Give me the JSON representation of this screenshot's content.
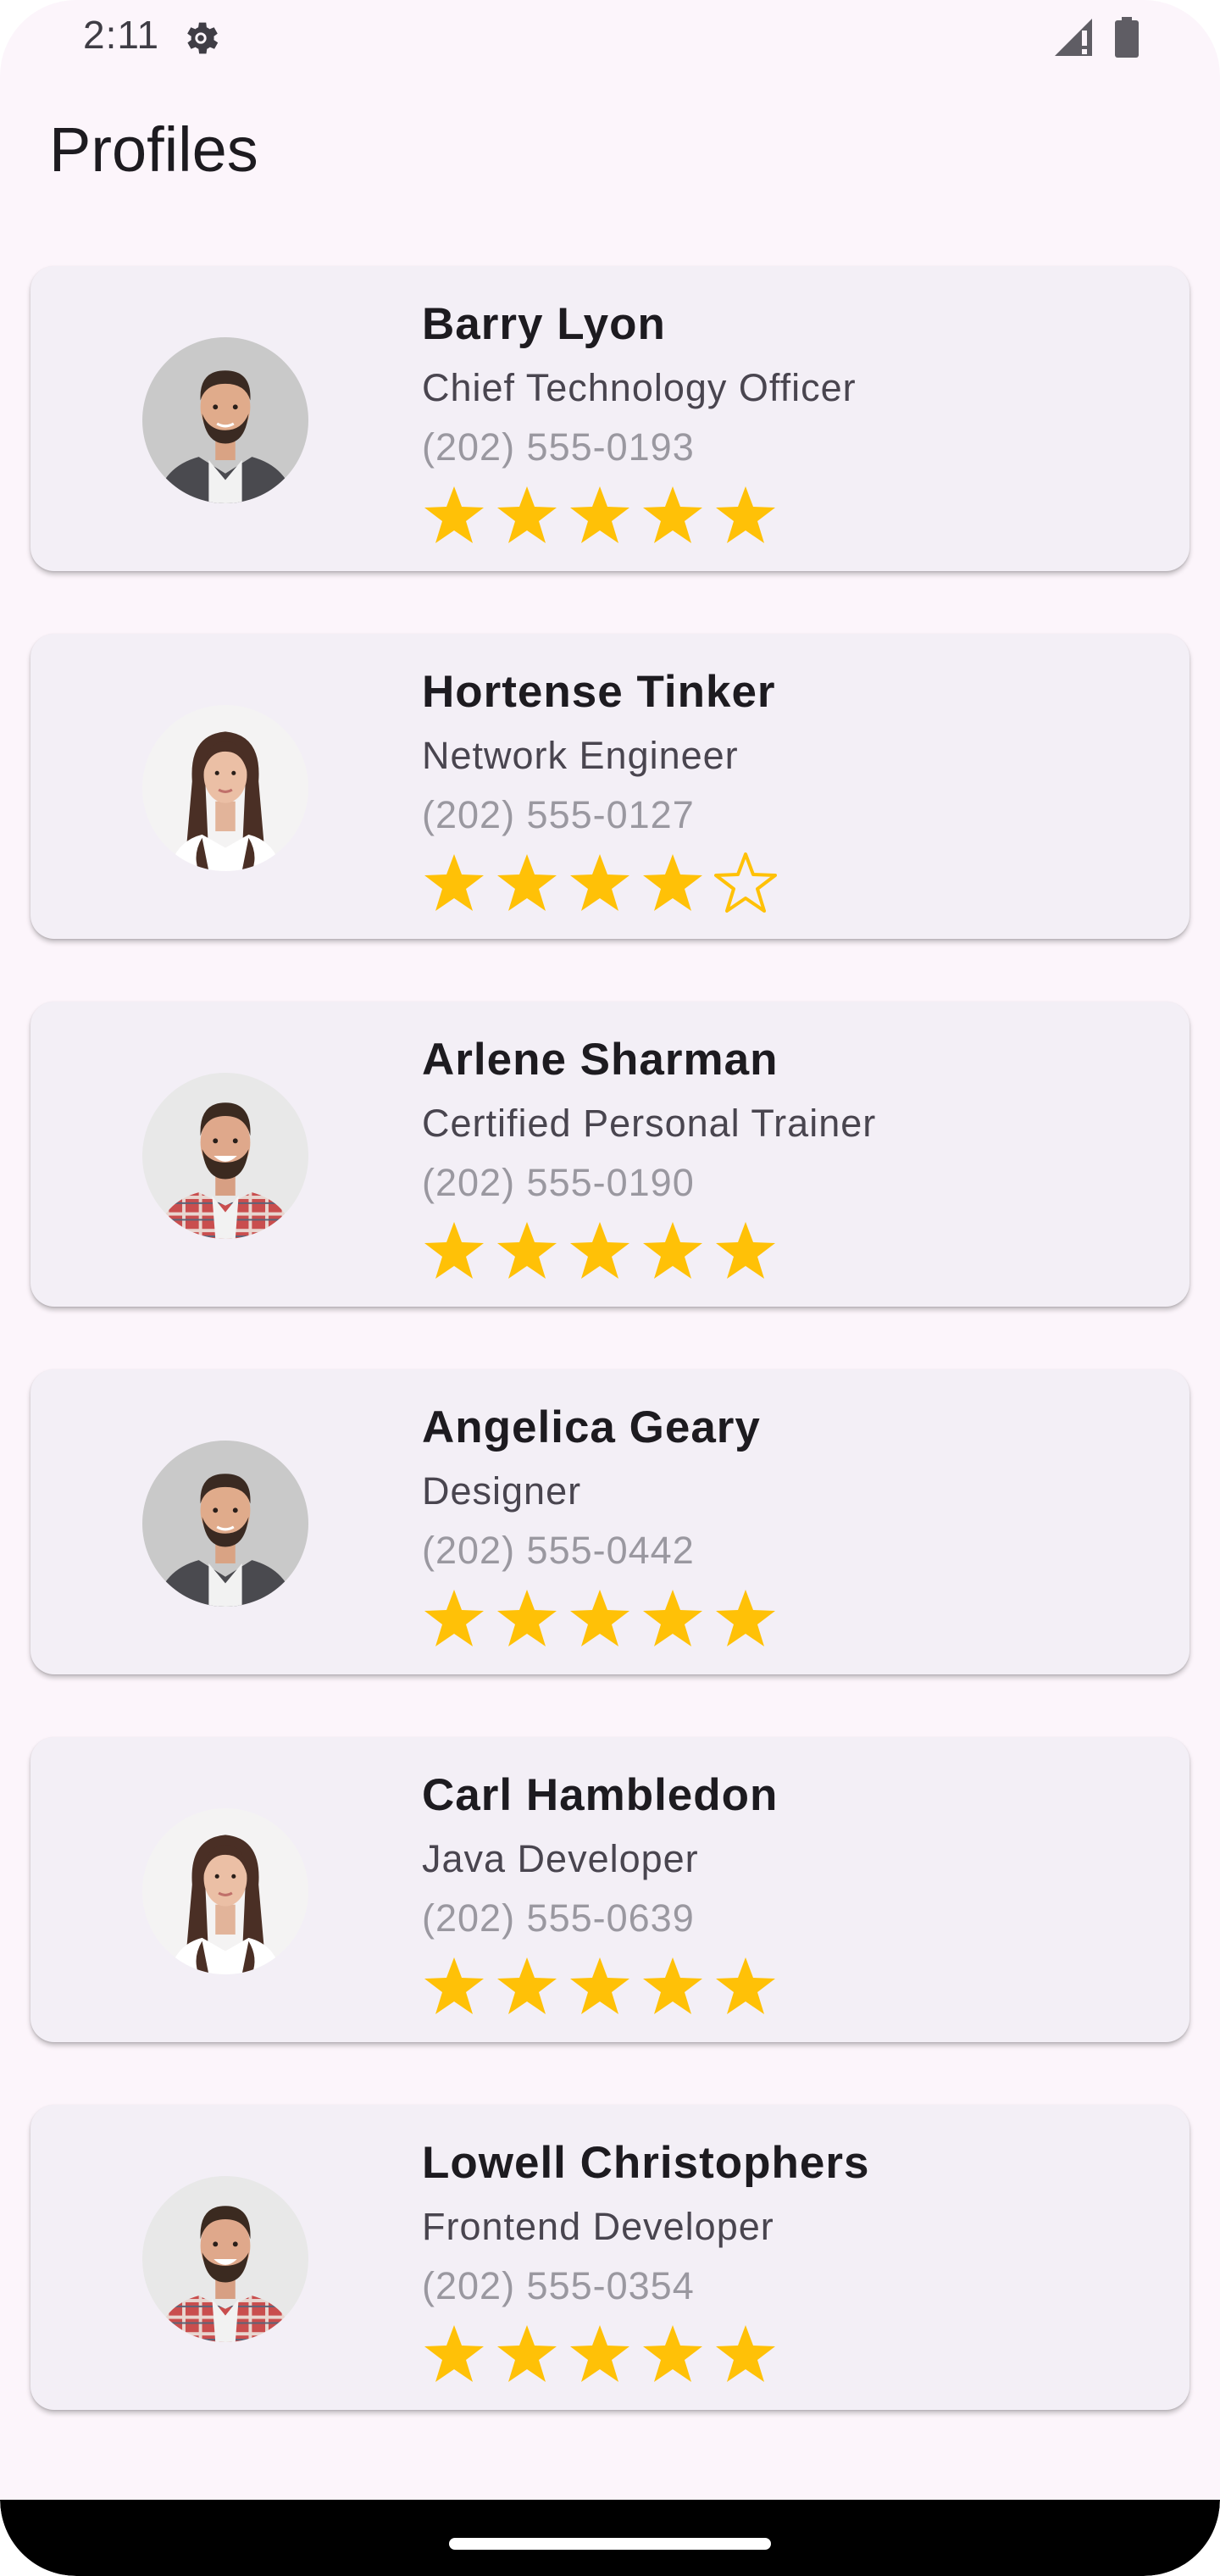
{
  "status_bar": {
    "time": "2:11",
    "icons": [
      "gear-icon",
      "signal-icon",
      "battery-icon"
    ]
  },
  "page": {
    "title": "Profiles"
  },
  "colors": {
    "background": "#fcf5fb",
    "card": "#f3eff6",
    "star": "#ffc107",
    "name": "#1d1b20",
    "job": "#49454f",
    "phone": "#9a98a0"
  },
  "profiles": [
    {
      "name": "Barry Lyon",
      "job": "Chief Technology Officer",
      "phone": "(202) 555-0193",
      "rating": 5,
      "avatar": "bearded-man-grey-suit"
    },
    {
      "name": "Hortense Tinker",
      "job": "Network Engineer",
      "phone": "(202) 555-0127",
      "rating": 4,
      "avatar": "woman-long-hair"
    },
    {
      "name": "Arlene Sharman",
      "job": "Certified Personal Trainer",
      "phone": "(202) 555-0190",
      "rating": 5,
      "avatar": "smiling-man-plaid-shirt"
    },
    {
      "name": "Angelica Geary",
      "job": "Designer",
      "phone": "(202) 555-0442",
      "rating": 5,
      "avatar": "bearded-man-grey-suit"
    },
    {
      "name": "Carl Hambledon",
      "job": "Java Developer",
      "phone": "(202) 555-0639",
      "rating": 5,
      "avatar": "woman-long-hair"
    },
    {
      "name": "Lowell Christophers",
      "job": "Frontend Developer",
      "phone": "(202) 555-0354",
      "rating": 5,
      "avatar": "smiling-man-plaid-shirt"
    }
  ]
}
